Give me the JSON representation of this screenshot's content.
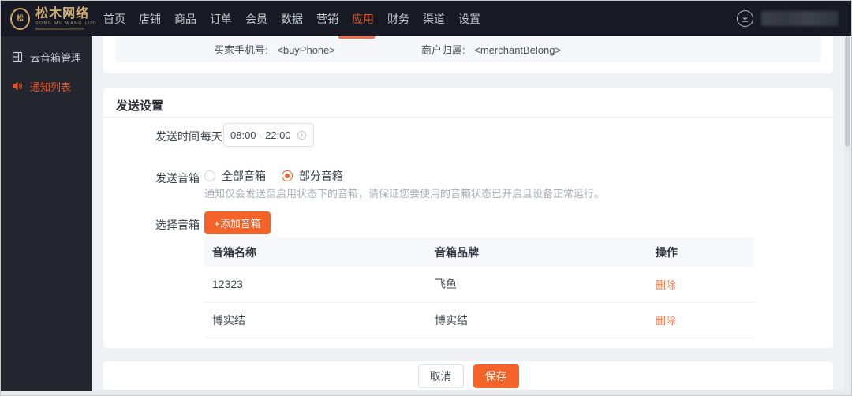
{
  "colors": {
    "accent": "#f4632a",
    "nav_active": "#e25a28",
    "delete_link": "#f57a52",
    "header_bg": "#171a24",
    "sidebar_bg": "#23252f"
  },
  "header": {
    "logo": {
      "brand": "松木网络",
      "subtitle": "SONG MU WANG LUO"
    },
    "nav": [
      {
        "label": "首页"
      },
      {
        "label": "店铺"
      },
      {
        "label": "商品"
      },
      {
        "label": "订单"
      },
      {
        "label": "会员"
      },
      {
        "label": "数据"
      },
      {
        "label": "营销"
      },
      {
        "label": "应用"
      },
      {
        "label": "财务"
      },
      {
        "label": "渠道"
      },
      {
        "label": "设置"
      }
    ],
    "active_nav": "应用"
  },
  "sidebar": {
    "items": [
      {
        "label": "云音箱管理",
        "icon": "list-icon",
        "active": false
      },
      {
        "label": "通知列表",
        "icon": "speaker-icon",
        "active": true
      }
    ]
  },
  "preview_card": {
    "fields": [
      {
        "label": "买家手机号:",
        "value": "<buyPhone>"
      },
      {
        "label": "商户归属:",
        "value": "<merchantBelong>"
      }
    ]
  },
  "settings_card": {
    "title": "发送设置",
    "send_time": {
      "label": "发送时间",
      "prefix": "每天",
      "value": "08:00 - 22:00"
    },
    "send_speaker": {
      "label": "发送音箱",
      "options": [
        {
          "label": "全部音箱",
          "selected": false
        },
        {
          "label": "部分音箱",
          "selected": true
        }
      ],
      "help": "通知仅会发送至启用状态下的音箱，请保证您要使用的音箱状态已开启且设备正常运行。"
    },
    "select_speaker": {
      "label": "选择音箱",
      "add_button": "+添加音箱"
    },
    "table": {
      "columns": [
        "音箱名称",
        "音箱品牌",
        "操作"
      ],
      "rows": [
        {
          "name": "12323",
          "brand": "飞鱼",
          "action": "删除"
        },
        {
          "name": "博实结",
          "brand": "博实结",
          "action": "删除"
        }
      ]
    }
  },
  "footer": {
    "cancel": "取消",
    "save": "保存"
  }
}
